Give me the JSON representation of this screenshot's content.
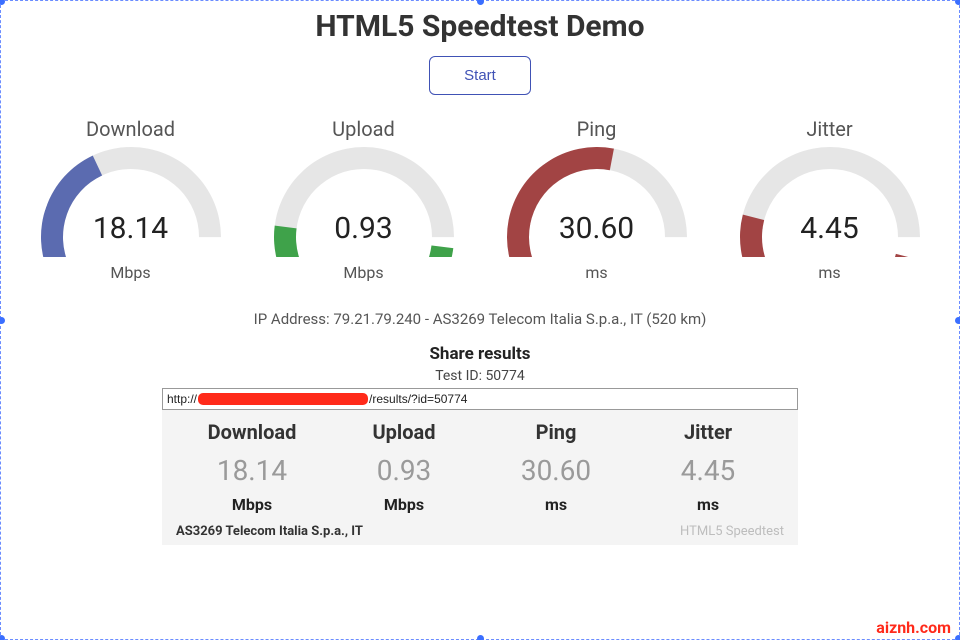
{
  "title": "HTML5 Speedtest Demo",
  "start_label": "Start",
  "gauges": {
    "download": {
      "label": "Download",
      "value": "18.14",
      "unit": "Mbps",
      "pct": 36,
      "color": "#5b6bb0"
    },
    "upload": {
      "label": "Upload",
      "value": "0.93",
      "unit": "Mbps",
      "pct": 4,
      "color": "#3fa24a"
    },
    "ping": {
      "label": "Ping",
      "value": "30.60",
      "unit": "ms",
      "pct": 56,
      "color": "#a24444"
    },
    "jitter": {
      "label": "Jitter",
      "value": "4.45",
      "unit": "ms",
      "pct": 8,
      "color": "#a24444"
    }
  },
  "ip_line": "IP Address: 79.21.79.240 - AS3269 Telecom Italia S.p.a., IT (520 km)",
  "share": {
    "title": "Share results",
    "test_id_label": "Test ID: 50774",
    "url_prefix": "http://",
    "url_suffix": "/results/?id=50774"
  },
  "card": {
    "download": {
      "label": "Download",
      "value": "18.14",
      "unit": "Mbps"
    },
    "upload": {
      "label": "Upload",
      "value": "0.93",
      "unit": "Mbps"
    },
    "ping": {
      "label": "Ping",
      "value": "30.60",
      "unit": "ms"
    },
    "jitter": {
      "label": "Jitter",
      "value": "4.45",
      "unit": "ms"
    },
    "isp": "AS3269 Telecom Italia S.p.a., IT",
    "brand": "HTML5 Speedtest"
  },
  "watermark": "aiznh.com"
}
